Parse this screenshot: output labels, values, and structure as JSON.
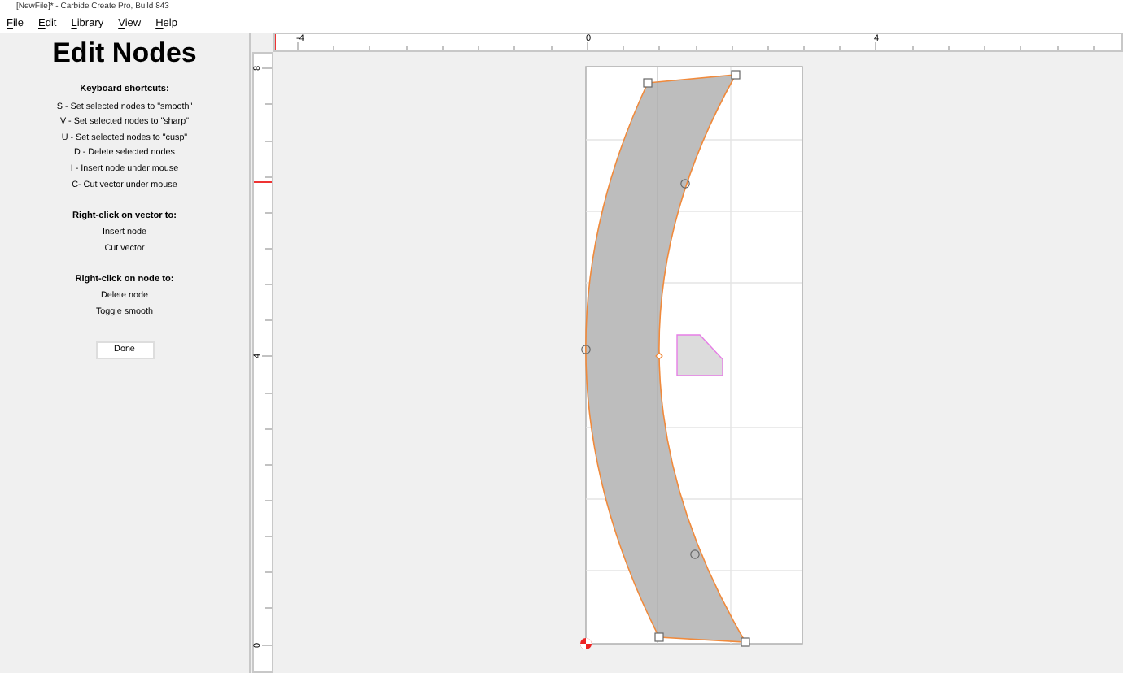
{
  "window": {
    "title": "[NewFile]* - Carbide Create Pro, Build 843"
  },
  "menu": [
    {
      "label": "File"
    },
    {
      "label": "Edit"
    },
    {
      "label": "Library"
    },
    {
      "label": "View"
    },
    {
      "label": "Help"
    }
  ],
  "panel": {
    "title": "Edit Nodes",
    "sections": [
      {
        "heading": "Keyboard shortcuts:",
        "items": [
          "S - Set selected nodes to \"smooth\"",
          "V - Set selected nodes to \"sharp\"",
          "U - Set selected nodes to \"cusp\"",
          "D - Delete selected nodes",
          "I - Insert node under mouse",
          "C- Cut vector under mouse"
        ]
      },
      {
        "heading": "Right-click on vector to:",
        "items": [
          "Insert node",
          "Cut vector"
        ]
      },
      {
        "heading": "Right-click on node to:",
        "items": [
          "Delete node",
          "Toggle smooth"
        ]
      }
    ],
    "button": "Done"
  },
  "ruler_top": {
    "labels": [
      "-4",
      "0",
      "4"
    ]
  },
  "ruler_left": {
    "labels": [
      "8",
      "4",
      "0"
    ]
  }
}
